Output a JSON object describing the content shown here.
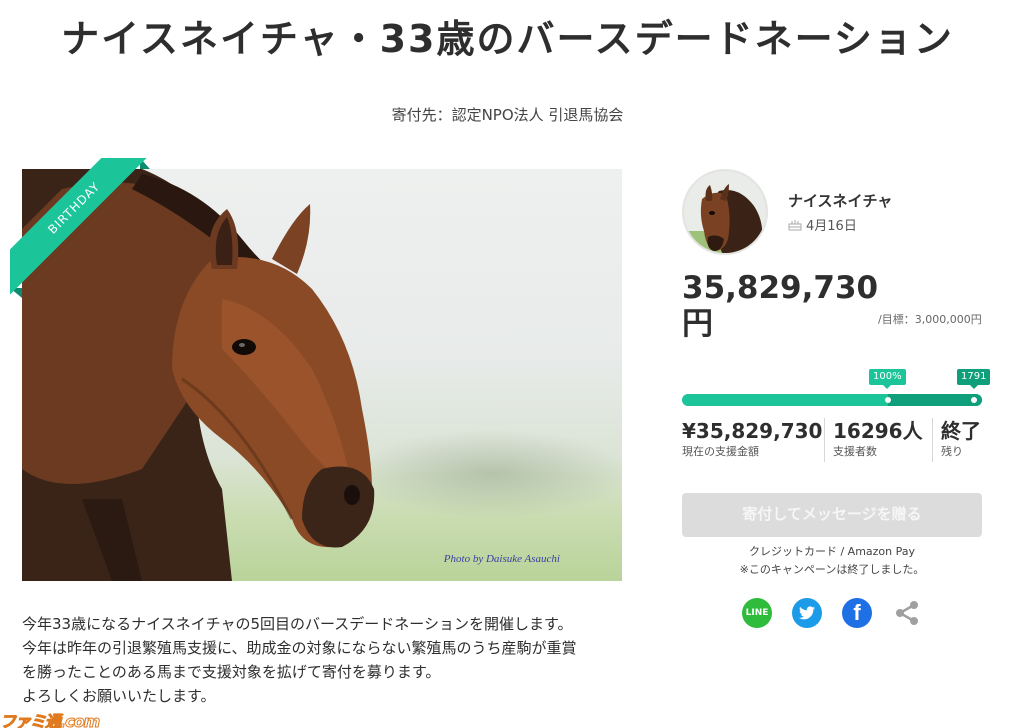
{
  "header": {
    "title": "ナイスネイチャ・33歳のバースデードネーション",
    "recipient": "寄付先：認定NPO法人 引退馬協会"
  },
  "hero": {
    "ribbon_label": "BIRTHDAY",
    "photo_credit": "Photo by Daisuke Asauchi"
  },
  "description": [
    "今年33歳になるナイスネイチャの5回目のバースデードネーションを開催します。",
    "今年は昨年の引退繁殖馬支援に、助成金の対象にならない繁殖馬のうち産駒が重賞",
    "を勝ったことのある馬まで支援対象を拡げて寄付を募ります。",
    "よろしくお願いいたします。"
  ],
  "profile": {
    "name": "ナイスネイチャ",
    "birthday": "4月16日",
    "birthday_icon": "cake-icon"
  },
  "funding": {
    "total_amount": "35,829,730円",
    "goal_text": "/目標：3,000,000円",
    "progress_tag_first": "100%",
    "progress_tag_second": "1791",
    "progress_fraction_first": 0.0558,
    "progress_fraction_total": 1.0
  },
  "stats": [
    {
      "value": "¥35,829,730",
      "label": "現在の支援金額"
    },
    {
      "value": "16296人",
      "label": "支援者数"
    },
    {
      "value": "終了",
      "label": "残り"
    }
  ],
  "actions": {
    "donate_label": "寄付してメッセージを贈る",
    "payment_methods": "クレジットカード / Amazon Pay",
    "campaign_status": "※このキャンペーンは終了しました。"
  },
  "share": {
    "line_label": "LINE",
    "facebook_label": "f",
    "icons": [
      "line-icon",
      "twitter-icon",
      "facebook-icon",
      "share-icon"
    ]
  },
  "watermark": "ファミ通.com",
  "colors": {
    "accent": "#1cc49a",
    "accent_dark": "#0f9f7a",
    "button_disabled": "#dcdcdc",
    "line": "#2fbb3b",
    "twitter": "#1c9be8",
    "facebook": "#1f6fe5"
  }
}
